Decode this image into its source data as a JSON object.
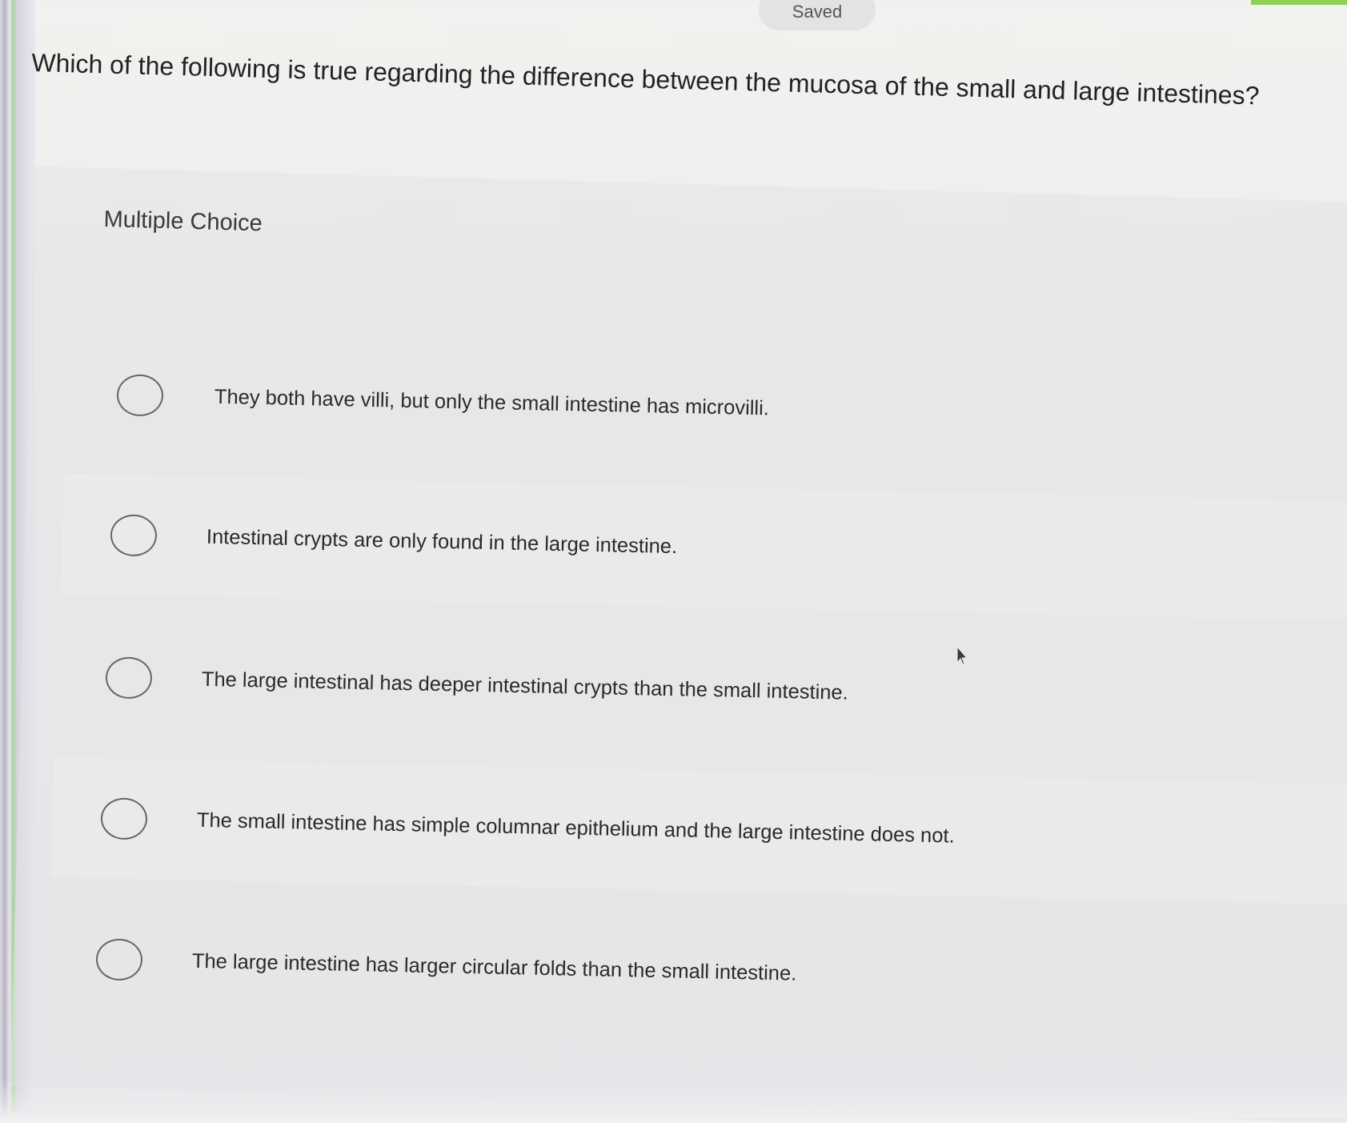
{
  "status": {
    "saved_label": "Saved"
  },
  "question": {
    "text": "Which of the following is true regarding the difference between the mucosa of the small and large intestines?"
  },
  "answer_type_label": "Multiple Choice",
  "options": [
    {
      "text": "They both have villi, but only the small intestine has microvilli.",
      "selected": false
    },
    {
      "text": "Intestinal crypts are only found in the large intestine.",
      "selected": false
    },
    {
      "text": "The large intestinal has deeper intestinal crypts than the small intestine.",
      "selected": false
    },
    {
      "text": "The small intestine has simple columnar epithelium and the large intestine does not.",
      "selected": false
    },
    {
      "text": "The large intestine has larger circular folds than the small intestine.",
      "selected": false
    }
  ],
  "colors": {
    "accent_green": "#8fd14f",
    "radio_border": "#666666",
    "text": "#2a2a2a"
  },
  "icons": {
    "cursor": "mouse-pointer-icon",
    "radio": "radio-button-icon"
  }
}
